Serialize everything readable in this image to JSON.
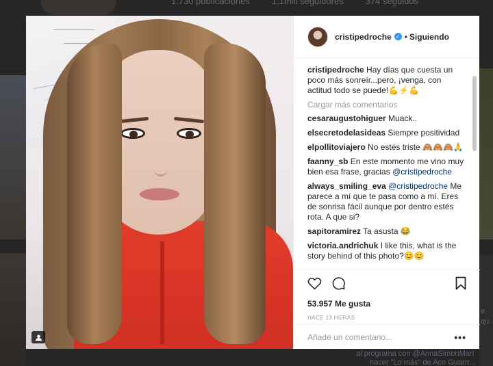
{
  "background": {
    "stats": [
      "1.730 publicaciones",
      "1,1mill seguidores",
      "374 seguidos"
    ],
    "caption_1": "al programa con @AnnaSimonMarí",
    "caption_2": "hacer \"Lo más\" de Aco Guarrr...",
    "right_text": "e qu"
  },
  "post": {
    "username": "cristipedroche",
    "separator": "•",
    "follow_status": "Siguiendo",
    "caption_user": "cristipedroche",
    "caption_text": "Hay días que cuesta un poco más sonreír...pero, ¡venga, con actitud todo se puede!💪⚡💪",
    "load_more": "Cargar más comentarios",
    "comments": [
      {
        "user": "cesaraugustohiguer",
        "text": "Muack.."
      },
      {
        "user": "elsecretodelasideas",
        "text": "Siempre positividad"
      },
      {
        "user": "elpollitoviajero",
        "text": "No estés triste 🙈🙈🙈🙏"
      },
      {
        "user": "faanny_sb",
        "text": "En este momento me vino muy bien esa frase, gracias",
        "mention": "@cristipedroche"
      },
      {
        "user": "always_smiling_eva",
        "mention": "@cristipedroche",
        "text": "Me parece a mí que te pasa como a mí. Eres de sonrisa fácil aunque por dentro estés rota. A que si?"
      },
      {
        "user": "sapitoramirez",
        "text": "Ta asusta 😂"
      },
      {
        "user": "victoria.andrichuk",
        "text": "I like this, what is the story behind of this photo?😊😊"
      }
    ],
    "likes": "53.957 Me gusta",
    "time": "HACE 13 HORAS",
    "add_comment_placeholder": "Añade un comentario...",
    "more_options": "•••"
  },
  "icons": [
    "heart-icon",
    "comment-icon",
    "bookmark-icon",
    "user-tag-icon",
    "verified-icon"
  ],
  "colors": {
    "verified": "#3897f0",
    "mention": "#003569",
    "muted": "#999999"
  }
}
